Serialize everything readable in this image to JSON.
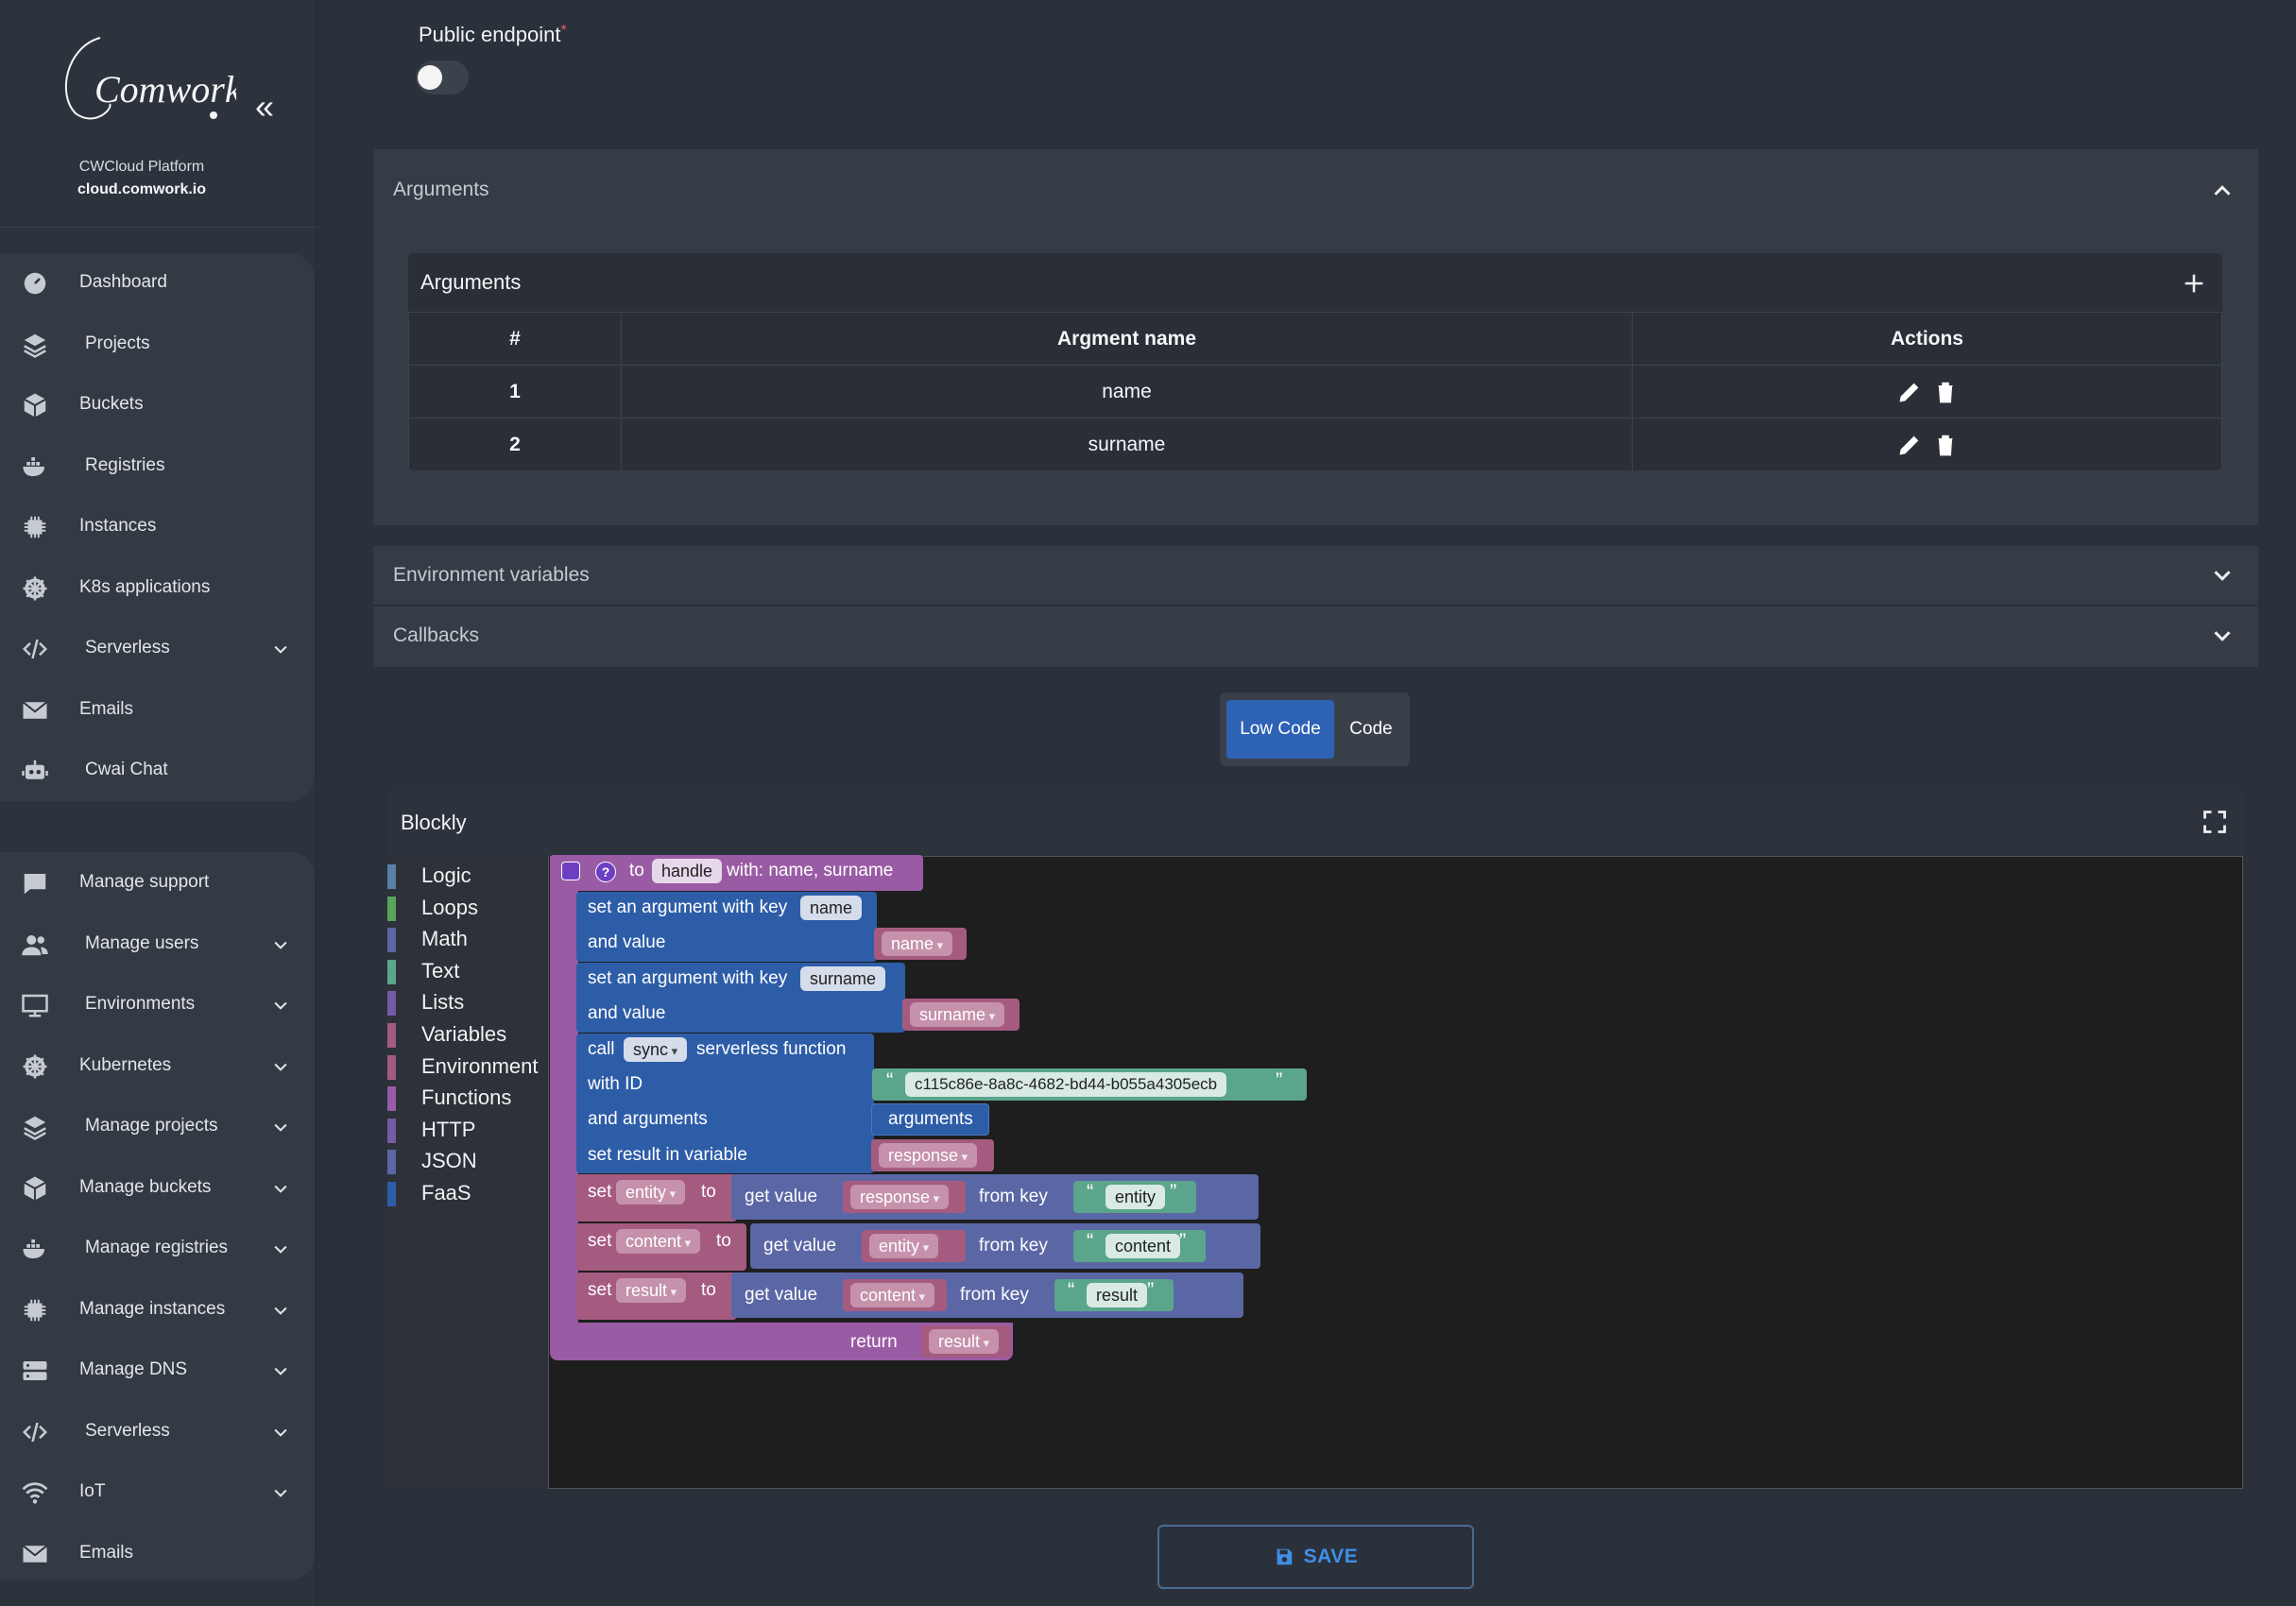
{
  "sidebar": {
    "logo_text": "Comwork",
    "platform_name": "CWCloud Platform",
    "platform_domain": "cloud.comwork.io",
    "group1": [
      {
        "label": "Dashboard",
        "icon": "dashboard-icon",
        "expand": false
      },
      {
        "label": "Projects",
        "icon": "layers-icon",
        "expand": false
      },
      {
        "label": "Buckets",
        "icon": "box-icon",
        "expand": false
      },
      {
        "label": "Registries",
        "icon": "docker-icon",
        "expand": false
      },
      {
        "label": "Instances",
        "icon": "cpu-icon",
        "expand": false
      },
      {
        "label": "K8s applications",
        "icon": "helm-icon",
        "expand": false
      },
      {
        "label": "Serverless",
        "icon": "code-icon",
        "expand": true
      },
      {
        "label": "Emails",
        "icon": "mail-icon",
        "expand": false
      },
      {
        "label": "Cwai Chat",
        "icon": "robot-icon",
        "expand": false
      }
    ],
    "group2": [
      {
        "label": "Manage support",
        "icon": "chat-icon",
        "expand": false
      },
      {
        "label": "Manage users",
        "icon": "users-icon",
        "expand": true
      },
      {
        "label": "Environments",
        "icon": "monitor-icon",
        "expand": true
      },
      {
        "label": "Kubernetes",
        "icon": "helm-icon",
        "expand": true
      },
      {
        "label": "Manage projects",
        "icon": "layers-icon",
        "expand": true
      },
      {
        "label": "Manage buckets",
        "icon": "box-icon",
        "expand": true
      },
      {
        "label": "Manage registries",
        "icon": "docker-icon",
        "expand": true
      },
      {
        "label": "Manage instances",
        "icon": "cpu-icon",
        "expand": true
      },
      {
        "label": "Manage DNS",
        "icon": "server-icon",
        "expand": true
      },
      {
        "label": "Serverless",
        "icon": "code-icon",
        "expand": true
      },
      {
        "label": "IoT",
        "icon": "wifi-icon",
        "expand": true
      },
      {
        "label": "Emails",
        "icon": "mail-icon",
        "expand": false
      }
    ]
  },
  "form": {
    "public_endpoint_label": "Public endpoint",
    "required_mark": "*",
    "public_endpoint_enabled": false
  },
  "arguments_panel": {
    "title": "Arguments",
    "table_title": "Arguments",
    "columns": [
      "#",
      "Argment name",
      "Actions"
    ],
    "rows": [
      {
        "index": "1",
        "name": "name"
      },
      {
        "index": "2",
        "name": "surname"
      }
    ]
  },
  "env_panel": {
    "title": "Environment variables"
  },
  "callbacks_panel": {
    "title": "Callbacks"
  },
  "mode_toggle": {
    "low_code": "Low Code",
    "code": "Code",
    "active": "Low Code"
  },
  "blockly": {
    "title": "Blockly",
    "toolbox": [
      {
        "label": "Logic",
        "color": "#5b80a5"
      },
      {
        "label": "Loops",
        "color": "#5ba55b"
      },
      {
        "label": "Math",
        "color": "#5b67a5"
      },
      {
        "label": "Text",
        "color": "#5ba58c"
      },
      {
        "label": "Lists",
        "color": "#745ba5"
      },
      {
        "label": "Variables",
        "color": "#a55b80"
      },
      {
        "label": "Environment",
        "color": "#a55b80"
      },
      {
        "label": "Functions",
        "color": "#995ba5"
      },
      {
        "label": "HTTP",
        "color": "#745ba5"
      },
      {
        "label": "JSON",
        "color": "#5b67a5"
      },
      {
        "label": "FaaS",
        "color": "#2e5da8"
      }
    ],
    "blocks": {
      "fn_to": "to",
      "fn_name": "handle",
      "fn_with": "with: name, surname",
      "set_arg1": "set an argument with key",
      "key1": "name",
      "and_value1": "and value",
      "val1": "name",
      "set_arg2": "set an argument with key",
      "key2": "surname",
      "and_value2": "and value",
      "val2": "surname",
      "call": "call",
      "call_mode": "sync",
      "call_rest": "serverless function",
      "with_id": "with ID",
      "id_value": "c115c86e-8a8c-4682-bd44-b055a4305ecb",
      "and_arguments": "and arguments",
      "arguments_value": "arguments",
      "set_result": "set result in variable",
      "result_var": "response",
      "set": "set",
      "to": "to",
      "get_value": "get value",
      "from_key": "from key",
      "s1_var": "entity",
      "s1_src": "response",
      "s1_key": "entity",
      "s2_var": "content",
      "s2_src": "entity",
      "s2_key": "content",
      "s3_var": "result",
      "s3_src": "content",
      "s3_key": "result",
      "return": "return",
      "return_var": "result"
    }
  },
  "save_label": "SAVE",
  "colors": {
    "accent": "#2d62b5",
    "procedure": "#9a5ba5",
    "faas": "#2e5da8",
    "variable": "#a55b80",
    "text": "#5ba58c",
    "json": "#5b67a5"
  }
}
